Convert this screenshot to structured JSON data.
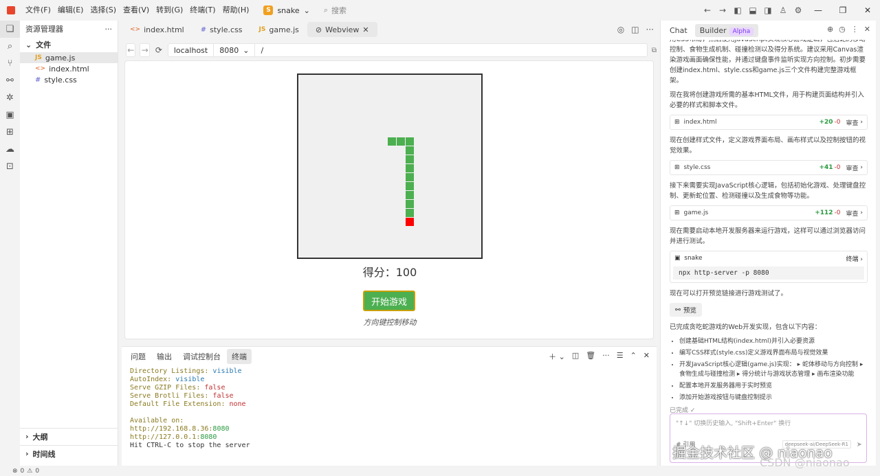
{
  "menu": [
    "文件(F)",
    "编辑(E)",
    "选择(S)",
    "查看(V)",
    "转到(G)",
    "终端(T)",
    "帮助(H)"
  ],
  "project": {
    "badge": "S",
    "name": "snake"
  },
  "search": {
    "placeholder": "搜索"
  },
  "sidebar": {
    "title": "资源管理器",
    "more": "···",
    "section": "文件",
    "files": [
      {
        "icon": "JS",
        "name": "game.js"
      },
      {
        "icon": "<>",
        "name": "index.html"
      },
      {
        "icon": "#",
        "name": "style.css"
      }
    ],
    "outline": "大纲",
    "timeline": "时间线"
  },
  "tabs": [
    {
      "icon": "<>",
      "label": "index.html"
    },
    {
      "icon": "#",
      "label": "style.css"
    },
    {
      "icon": "JS",
      "label": "game.js"
    },
    {
      "icon": "⊘",
      "label": "Webview"
    }
  ],
  "url": {
    "host": "localhost",
    "port": "8080",
    "path": "/"
  },
  "game": {
    "score": "得分：100",
    "start": "开始游戏",
    "hint": "方向键控制移动",
    "snake": [
      {
        "col": 10,
        "row": 7
      },
      {
        "col": 11,
        "row": 7
      },
      {
        "col": 12,
        "row": 7
      },
      {
        "col": 12,
        "row": 8
      },
      {
        "col": 12,
        "row": 9
      },
      {
        "col": 12,
        "row": 10
      },
      {
        "col": 12,
        "row": 11
      },
      {
        "col": 12,
        "row": 12
      },
      {
        "col": 12,
        "row": 13
      },
      {
        "col": 12,
        "row": 14
      },
      {
        "col": 12,
        "row": 15
      },
      {
        "col": 12,
        "row": 16
      }
    ],
    "snake_color": "#4caf50",
    "head_color": "#ff0000"
  },
  "panel": {
    "tabs": [
      "问题",
      "输出",
      "调试控制台",
      "终端"
    ],
    "terminal": [
      {
        "k": "Directory Listings: ",
        "v": "visible",
        "c": "blue"
      },
      {
        "k": "AutoIndex: ",
        "v": "visible",
        "c": "blue"
      },
      {
        "k": "Serve GZIP Files: ",
        "v": "false",
        "c": "red"
      },
      {
        "k": "Serve Brotli Files: ",
        "v": "false",
        "c": "red"
      },
      {
        "k": "Default File Extension: ",
        "v": "none",
        "c": "red"
      },
      {
        "k": "",
        "v": "",
        "c": ""
      },
      {
        "k": "Available on:",
        "v": "",
        "c": ""
      },
      {
        "k": "  http://192.168.8.36:",
        "v": "8080",
        "c": "green"
      },
      {
        "k": "  http://127.0.0.1:",
        "v": "8080",
        "c": "green"
      },
      {
        "k": "Hit CTRL-C to stop the server",
        "v": "",
        "c": "plain"
      }
    ]
  },
  "chat": {
    "tab_chat": "Chat",
    "tab_builder": "Builder",
    "alpha": "Alpha",
    "p1": "用CSS布局，然后使用JavaScript实现核心游戏逻辑，包括蛇的移动控制、食物生成机制、碰撞检测以及得分系统。建议采用Canvas渲染游戏画面确保性能，并通过键盘事件监听实现方向控制。初步需要创建index.html、style.css和game.js三个文件构建完整游戏框架。",
    "p2": "现在我将创建游戏所需的基本HTML文件，用于构建页面结构并引入必要的样式和脚本文件。",
    "f1": {
      "name": "index.html",
      "plus": "+20",
      "minus": "-0",
      "review": "审查"
    },
    "p3": "现在创建样式文件，定义游戏界面布局、画布样式以及控制按钮的视觉效果。",
    "f2": {
      "name": "style.css",
      "plus": "+41",
      "minus": "-0",
      "review": "审查"
    },
    "p4": "接下来需要实现JavaScript核心逻辑，包括初始化游戏、处理键盘控制、更新蛇位置、检测碰撞以及生成食物等功能。",
    "f3": {
      "name": "game.js",
      "plus": "+112",
      "minus": "-0",
      "review": "审查"
    },
    "p5": "现在需要启动本地开发服务器来运行游戏，这样可以通过浏览器访问并进行测试。",
    "cmd": {
      "name": "snake",
      "label": "终端",
      "command": "npx http-server -p 8080"
    },
    "p6": "现在可以打开预览链接进行游戏测试了。",
    "preview": "预览",
    "p7": "已完成贪吃蛇游戏的Web开发实现，包含以下内容：",
    "list": [
      "创建基础HTML结构(index.html)并引入必要资源",
      "编写CSS样式(style.css)定义游戏界面布局与视觉效果",
      "开发JavaScript核心逻辑(game.js)实现： ▸ 蛇体移动与方向控制 ▸ 食物生成与碰撞检测 ▸ 得分统计与游戏状态管理 ▸ 画布渲染功能",
      "配置本地开发服务器用于实时预览",
      "添加开始游戏按钮与键盘控制提示"
    ],
    "done": "已完成 ✓",
    "input_placeholder": "\"↑↓\" 切换历史输入, \"Shift+Enter\" 换行",
    "attach": "# 引用",
    "model": "deepseek-ai/DeepSeek-R1"
  },
  "status": {
    "errors": "0",
    "warnings": "0"
  },
  "watermark": "掘金技术社区 @ niaonao",
  "watermark2": "CSDN @niaonao"
}
